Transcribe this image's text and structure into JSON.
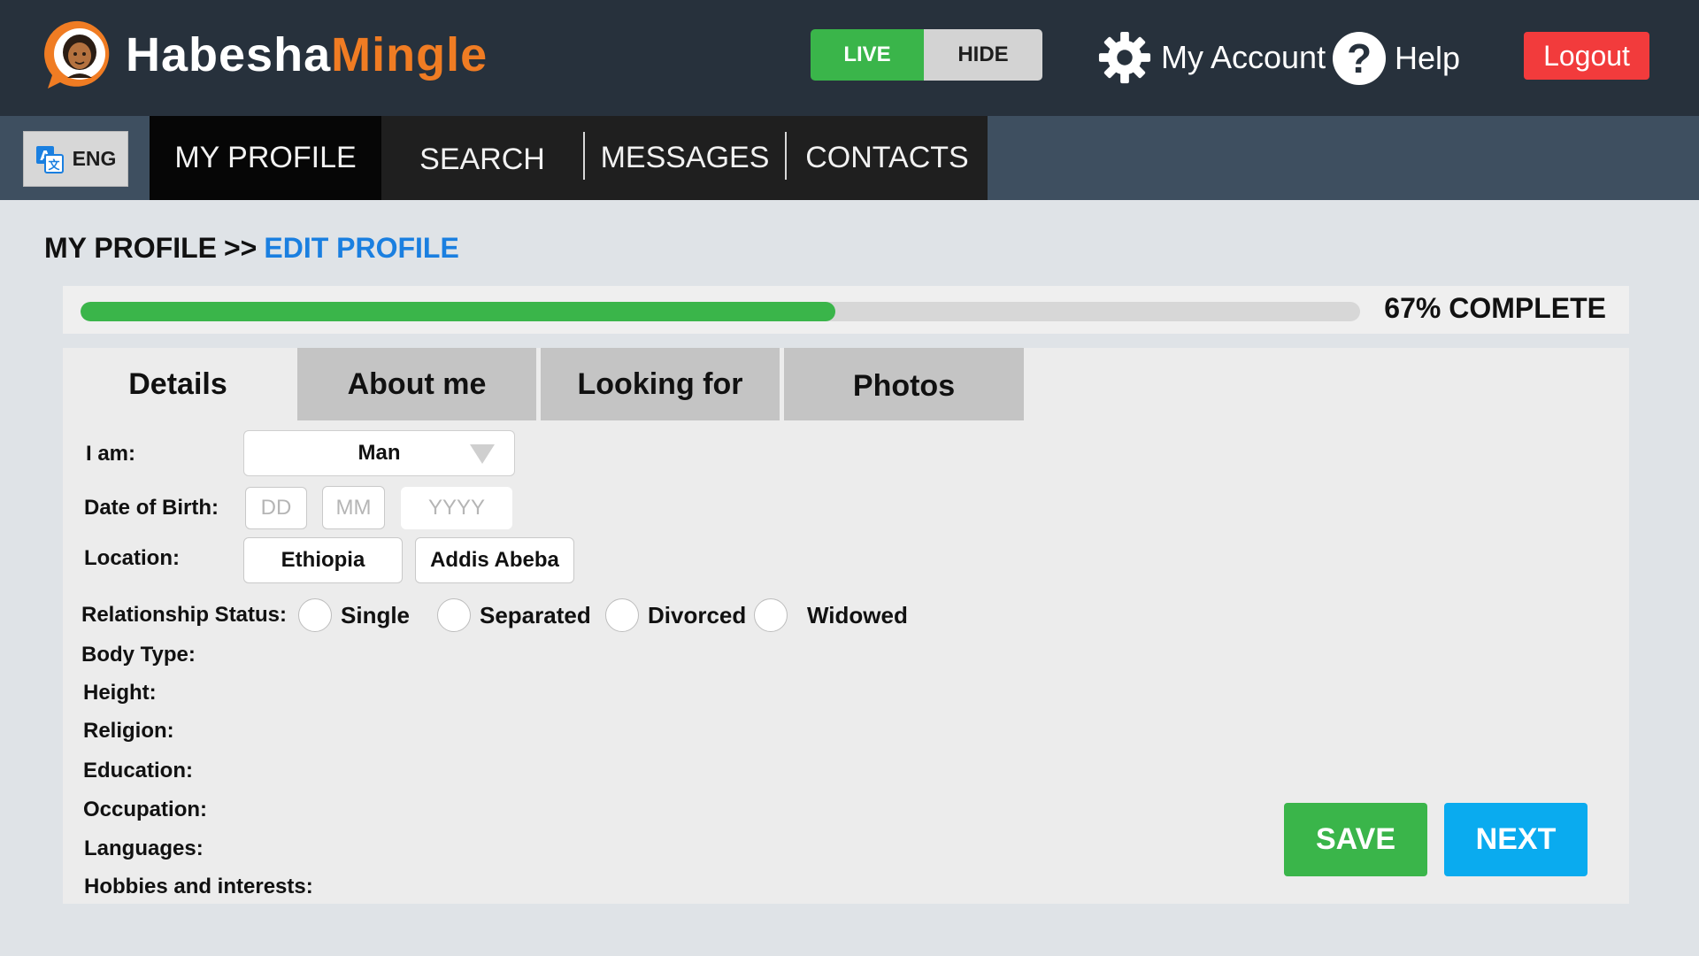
{
  "header": {
    "logo_part1": "Habesha",
    "logo_part2": "Mingle",
    "live_label": "LIVE",
    "hide_label": "HIDE",
    "account_label": "My Account",
    "help_label": "Help",
    "help_glyph": "?",
    "logout_label": "Logout"
  },
  "nav": {
    "language_label": "ENG",
    "tabs": [
      {
        "label": "MY PROFILE",
        "active": true
      },
      {
        "label": "SEARCH",
        "active": false
      },
      {
        "label": "MESSAGES",
        "active": false
      },
      {
        "label": "CONTACTS",
        "active": false
      }
    ]
  },
  "breadcrumb": {
    "parent": "MY PROFILE",
    "separator": ">>",
    "current": "EDIT PROFILE"
  },
  "progress": {
    "percent": 67,
    "fill_fraction": 0.59,
    "label": "67% COMPLETE"
  },
  "form": {
    "tabs": [
      {
        "label": "Details",
        "active": true
      },
      {
        "label": "About me",
        "active": false
      },
      {
        "label": "Looking for",
        "active": false
      },
      {
        "label": "Photos",
        "active": false
      }
    ],
    "i_am_label": "I am:",
    "i_am_value": "Man",
    "dob_label": "Date of Birth:",
    "dob_day_placeholder": "DD",
    "dob_month_placeholder": "MM",
    "dob_year_placeholder": "YYYY",
    "location_label": "Location:",
    "location_country": "Ethiopia",
    "location_city": "Addis Abeba",
    "relationship_label": "Relationship Status:",
    "relationship_options": [
      "Single",
      "Separated",
      "Divorced",
      "Widowed"
    ],
    "body_type_label": "Body Type:",
    "height_label": "Height:",
    "religion_label": "Religion:",
    "education_label": "Education:",
    "occupation_label": "Occupation:",
    "languages_label": "Languages:",
    "hobbies_label": "Hobbies and interests:",
    "save_label": "SAVE",
    "next_label": "NEXT"
  },
  "colors": {
    "header_bg": "#27313c",
    "nav_bg": "#3e4f60",
    "brand_orange": "#f07c23",
    "live_green": "#3ab54a",
    "logout_red": "#f23b3c",
    "link_blue": "#1a7fe0",
    "next_blue": "#0aabef"
  },
  "icons": {
    "logo": "avatar-speech-bubble-icon",
    "account": "gear-icon",
    "help": "question-circle-icon",
    "language": "translate-icon",
    "select": "chevron-down-icon"
  }
}
